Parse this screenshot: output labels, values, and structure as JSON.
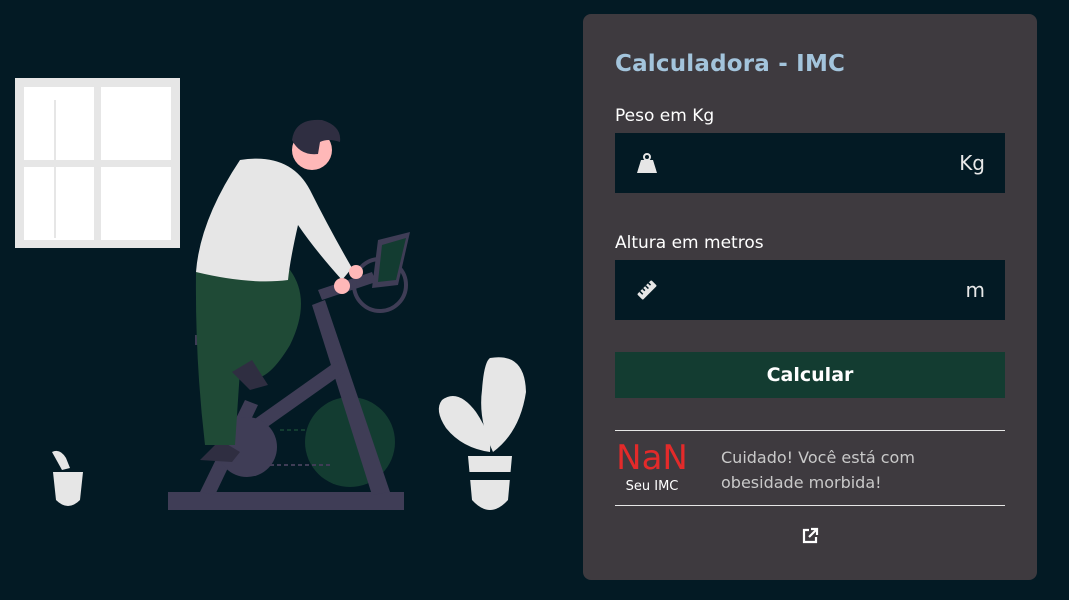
{
  "app": {
    "title": "Calculadora - IMC"
  },
  "form": {
    "weight_label": "Peso em Kg",
    "weight_value": "",
    "weight_unit": "Kg",
    "height_label": "Altura em metros",
    "height_value": "",
    "height_unit": "m",
    "submit_label": "Calcular"
  },
  "result": {
    "value": "NaN",
    "caption": "Seu IMC",
    "message": "Cuidado! Você está com obesidade morbida!"
  },
  "icons": {
    "weight": "weight-icon",
    "ruler": "ruler-icon",
    "external": "external-link-icon"
  },
  "colors": {
    "background": "#031a24",
    "card": "#3e3a3f",
    "title": "#a3c4dc",
    "button": "#133c31",
    "result_value": "#e32a2a"
  }
}
